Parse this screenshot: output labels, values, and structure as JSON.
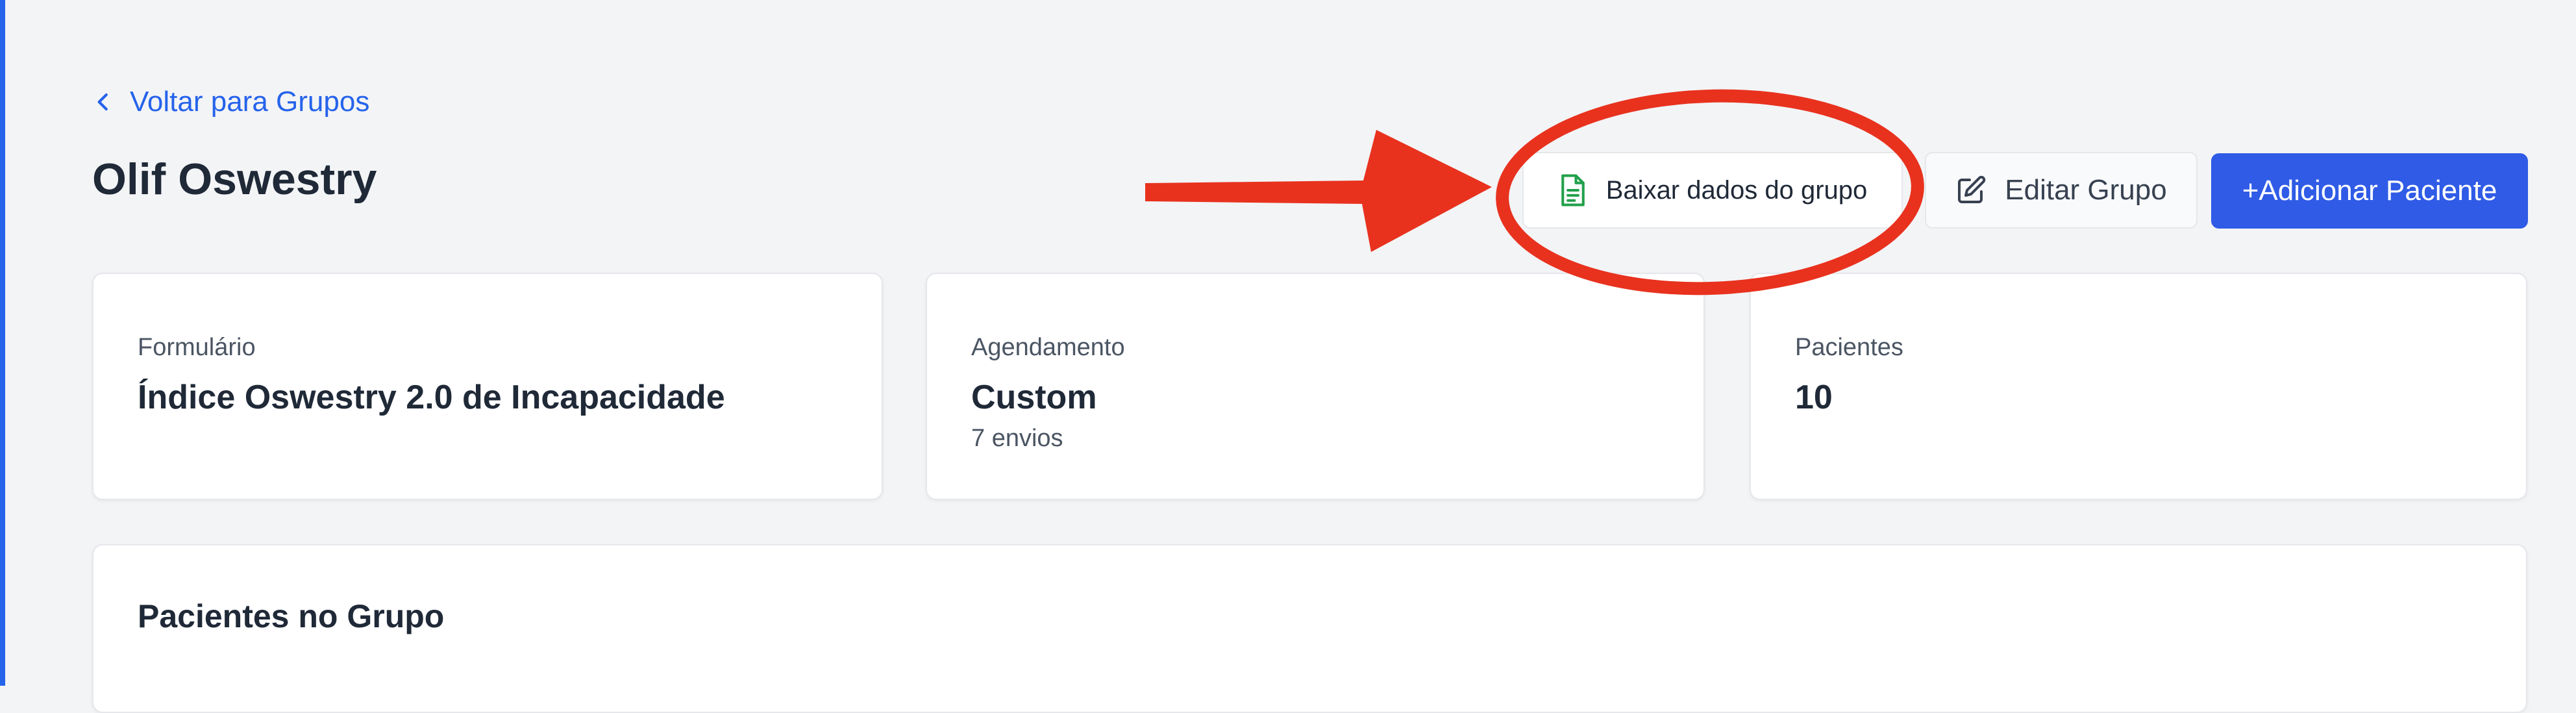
{
  "nav": {
    "back_label": "Voltar para Grupos",
    "back_icon": "chevron-left-icon"
  },
  "header": {
    "title": "Olif Oswestry"
  },
  "actions": {
    "download_label": "Baixar dados do grupo",
    "download_icon": "document-icon",
    "edit_label": "Editar Grupo",
    "edit_icon": "pencil-square-icon",
    "add_label": "+Adicionar Paciente"
  },
  "cards": {
    "form": {
      "label": "Formulário",
      "value": "Índice Oswestry 2.0 de Incapacidade"
    },
    "schedule": {
      "label": "Agendamento",
      "value": "Custom",
      "sub": "7 envios"
    },
    "patients": {
      "label": "Pacientes",
      "value": "10"
    }
  },
  "section": {
    "title": "Pacientes no Grupo"
  },
  "colors": {
    "accent": "#2563eb",
    "primary_button": "#2f5be6",
    "annotation": "#e8321e",
    "document_icon": "#22a04b",
    "background": "#f3f4f6"
  }
}
